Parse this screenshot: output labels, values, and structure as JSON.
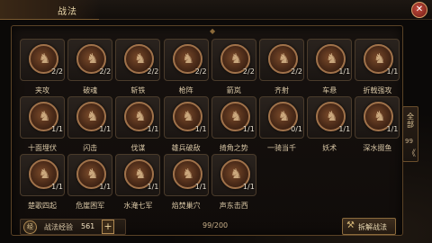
{
  "header": {
    "title": "战法",
    "close_icon": "close-icon",
    "close_glyph": "✕"
  },
  "tactics": [
    {
      "name": "夹攻",
      "count": "2/2"
    },
    {
      "name": "破魂",
      "count": "2/2"
    },
    {
      "name": "斩铁",
      "count": "2/2"
    },
    {
      "name": "枪阵",
      "count": "2/2"
    },
    {
      "name": "箭岚",
      "count": "2/2"
    },
    {
      "name": "齐射",
      "count": "2/2"
    },
    {
      "name": "车悬",
      "count": "1/1"
    },
    {
      "name": "折戟强攻",
      "count": "1/1"
    },
    {
      "name": "十面埋伏",
      "count": "1/1"
    },
    {
      "name": "闪击",
      "count": "1/1"
    },
    {
      "name": "伐谋",
      "count": "1/1"
    },
    {
      "name": "雄兵破敌",
      "count": "1/1"
    },
    {
      "name": "掎角之势",
      "count": "1/1"
    },
    {
      "name": "一骑当千",
      "count": "0/1"
    },
    {
      "name": "妖术",
      "count": "1/1"
    },
    {
      "name": "深水掇鱼",
      "count": "1/1"
    },
    {
      "name": "楚歌四起",
      "count": "1/1"
    },
    {
      "name": "危崖困军",
      "count": "1/1"
    },
    {
      "name": "水淹七军",
      "count": "1/1"
    },
    {
      "name": "焰焚巢穴",
      "count": "1/1"
    },
    {
      "name": "声东击西",
      "count": "1/1"
    }
  ],
  "side_tab": {
    "label": "全部",
    "count": "99",
    "arrow": "《"
  },
  "footer": {
    "exp_icon_text": "经",
    "exp_label": "战法经验",
    "exp_value": "561",
    "add_label": "+",
    "capacity": "99/200",
    "decompose_label": "拆解战法",
    "decompose_icon": "hammer-icon"
  },
  "colors": {
    "accent": "#a0724a",
    "close": "#c24a3c"
  }
}
